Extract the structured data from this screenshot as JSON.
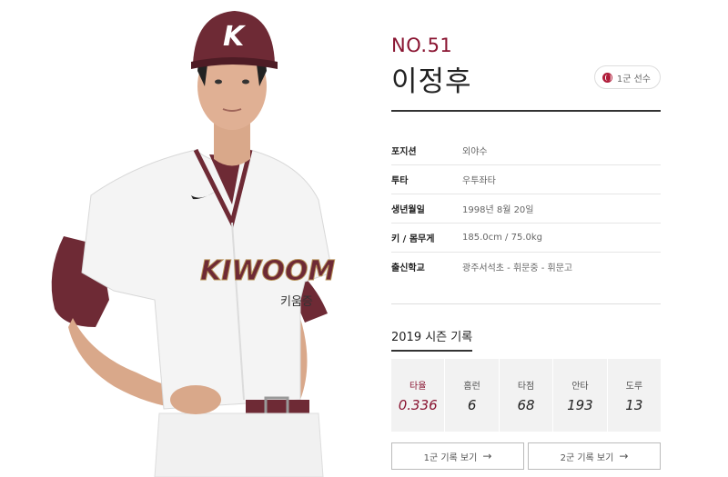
{
  "player": {
    "number": "NO.51",
    "name": "이정후",
    "squad_badge": "1군 선수",
    "cap_letter": "K",
    "jersey_text": "KIWOOM",
    "jersey_sub_text": "키움증"
  },
  "info": [
    {
      "label": "포지션",
      "value": "외야수"
    },
    {
      "label": "투타",
      "value": "우투좌타"
    },
    {
      "label": "생년월일",
      "value": "1998년 8월 20일"
    },
    {
      "label": "키 / 몸무게",
      "value": "185.0cm / 75.0kg"
    },
    {
      "label": "출신학교",
      "value": "광주서석초 - 휘문중 - 휘문고"
    }
  ],
  "season": {
    "title": "2019 시즌 기록",
    "stats": [
      {
        "label": "타율",
        "value": "0.336"
      },
      {
        "label": "홈런",
        "value": "6"
      },
      {
        "label": "타점",
        "value": "68"
      },
      {
        "label": "안타",
        "value": "193"
      },
      {
        "label": "도루",
        "value": "13"
      }
    ]
  },
  "buttons": {
    "first_team": "1군 기록 보기",
    "second_team": "2군 기록 보기"
  },
  "colors": {
    "accent": "#8a1532",
    "uniform_maroon": "#6e2a35"
  }
}
